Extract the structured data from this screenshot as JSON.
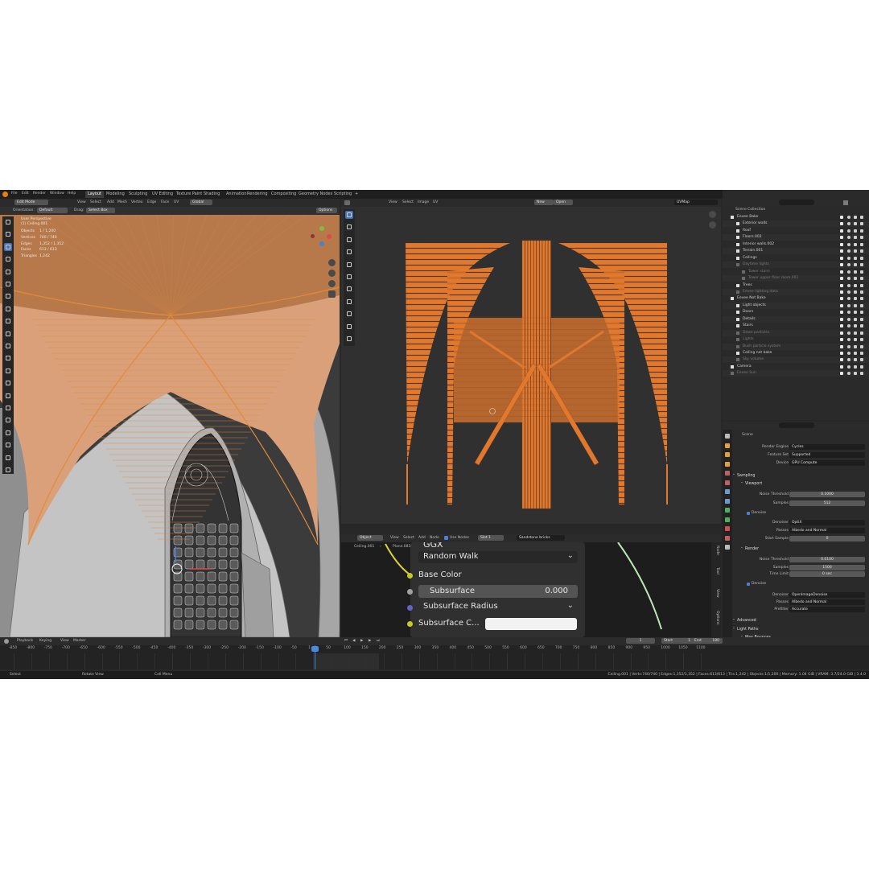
{
  "topbar": {
    "menus": [
      "File",
      "Edit",
      "Render",
      "Window",
      "Help"
    ],
    "workspaces": [
      "Layout",
      "Modeling",
      "Sculpting",
      "UV Editing",
      "Texture Paint",
      "Shading",
      "Animation",
      "Rendering",
      "Compositing",
      "Geometry Nodes",
      "Scripting"
    ],
    "active_workspace": "Layout",
    "add_tab": "+",
    "scene": "Scene",
    "view_layer": "ViewLayer"
  },
  "viewport": {
    "mode": "Edit Mode",
    "menus": [
      "View",
      "Select",
      "Add",
      "Mesh",
      "Vertex",
      "Edge",
      "Face",
      "UV"
    ],
    "transform": "Global",
    "orientation_label": "Orientation:",
    "orientation_value": "Default",
    "drag_label": "Drag:",
    "drag_value": "Select Box",
    "options": "Options",
    "title": "User Perspective",
    "object": "(1) Ceiling.001",
    "stats": [
      {
        "label": "Objects",
        "value": "1 / 1,200"
      },
      {
        "label": "Vertices",
        "value": "740 / 740"
      },
      {
        "label": "Edges",
        "value": "1,352 / 1,352"
      },
      {
        "label": "Faces",
        "value": "613 / 613"
      },
      {
        "label": "Triangles",
        "value": "1,242"
      }
    ],
    "gizmo_axes": [
      "X",
      "Y",
      "Z"
    ],
    "colors": {
      "mesh": "#d98a45",
      "wall": "#c4c4c4",
      "bg": "#3a3a3a"
    }
  },
  "uv_editor": {
    "menus": [
      "View",
      "Select",
      "Image",
      "UV"
    ],
    "new_label": "New",
    "open_label": "Open",
    "uvmap": "UVMap",
    "colors": {
      "island": "#e0782e",
      "edge": "#9a4e1e",
      "bg": "#303030"
    }
  },
  "node_editor": {
    "mode": "Object",
    "menus": [
      "View",
      "Select",
      "Add",
      "Node"
    ],
    "use_nodes": "Use Nodes",
    "slot": "Slot 1",
    "material": "Sandstone bricks",
    "breadcrumb": [
      "Ceiling.001",
      "Plane.083",
      "Sandstone bricks"
    ],
    "header_text": "GGX",
    "subsurface_method": "Random Walk",
    "sockets": [
      {
        "label": "Base Color"
      },
      {
        "label": "Subsurface",
        "value": "0.000"
      },
      {
        "label": "Subsurface Radius"
      },
      {
        "label": "Subsurface C..."
      }
    ],
    "side_tabs": [
      "Node",
      "Tool",
      "View",
      "Options"
    ]
  },
  "outliner": {
    "root": "Scene Collection",
    "items": [
      {
        "name": "Eevee Bake",
        "depth": 0
      },
      {
        "name": "Exterior walls",
        "depth": 1
      },
      {
        "name": "Roof",
        "depth": 1
      },
      {
        "name": "Floors.002",
        "depth": 1
      },
      {
        "name": "Interior walls.002",
        "depth": 1
      },
      {
        "name": "Terrain.001",
        "depth": 1
      },
      {
        "name": "Ceilings",
        "depth": 1
      },
      {
        "name": "Daytime lights",
        "depth": 1,
        "dim": true
      },
      {
        "name": "Tower stairs",
        "depth": 2,
        "dim": true
      },
      {
        "name": "Tower upper floor room.001",
        "depth": 2,
        "dim": true
      },
      {
        "name": "Trees",
        "depth": 1
      },
      {
        "name": "Eevee lighting data",
        "depth": 1,
        "dim": true
      },
      {
        "name": "Eevee Not Bake",
        "depth": 0
      },
      {
        "name": "Light objects",
        "depth": 1
      },
      {
        "name": "Doors",
        "depth": 1
      },
      {
        "name": "Details",
        "depth": 1
      },
      {
        "name": "Stairs",
        "depth": 1
      },
      {
        "name": "Dowe particles",
        "depth": 1,
        "dim": true
      },
      {
        "name": "Lights",
        "depth": 1,
        "dim": true
      },
      {
        "name": "Bush particle system",
        "depth": 1,
        "dim": true
      },
      {
        "name": "Ceiling not bake",
        "depth": 1
      },
      {
        "name": "Sky volume",
        "depth": 1,
        "dim": true
      },
      {
        "name": "Camera",
        "depth": 0
      },
      {
        "name": "Eevee Sun",
        "depth": 0,
        "dim": true
      }
    ]
  },
  "properties": {
    "context": "Scene",
    "render_engine_label": "Render Engine",
    "render_engine": "Cycles",
    "feature_set_label": "Feature Set",
    "feature_set": "Supported",
    "device_label": "Device",
    "device": "GPU Compute",
    "sampling": "Sampling",
    "viewport": "Viewport",
    "noise_threshold_label": "Noise Threshold",
    "viewport_noise_threshold": "0.1000",
    "samples_label": "Samples",
    "viewport_samples": "512",
    "denoise_label": "Denoise",
    "denoiser_label": "Denoiser",
    "viewport_denoiser": "OptiX",
    "passes_label": "Passes",
    "viewport_passes": "Albedo and Normal",
    "start_sample_label": "Start Sample",
    "viewport_start_sample": "0",
    "render": "Render",
    "render_noise_threshold": "0.0100",
    "render_samples": "1500",
    "time_limit_label": "Time Limit",
    "time_limit": "0 sec",
    "render_denoiser": "OpenImageDenoise",
    "render_passes": "Albedo and Normal",
    "prefilter_label": "Prefilter",
    "prefilter": "Accurate",
    "advanced": "Advanced",
    "light_paths": "Light Paths",
    "max_bounces": "Max Bounces",
    "total_label": "Total",
    "total": "12",
    "diffuse_label": "Diffuse",
    "diffuse": "4",
    "glossy_label": "Glossy",
    "glossy": "4"
  },
  "timeline": {
    "menus": [
      "Playback",
      "Keying",
      "View",
      "Marker"
    ],
    "current_frame": "1",
    "start_label": "Start",
    "start": "1",
    "end_label": "End",
    "end": "180",
    "ticks": [
      "-850",
      "-800",
      "-750",
      "-700",
      "-650",
      "-600",
      "-550",
      "-500",
      "-450",
      "-400",
      "-350",
      "-300",
      "-250",
      "-200",
      "-150",
      "-100",
      "-50",
      "1",
      "50",
      "100",
      "150",
      "200",
      "250",
      "300",
      "350",
      "400",
      "450",
      "500",
      "550",
      "600",
      "650",
      "700",
      "750",
      "800",
      "850",
      "900",
      "950",
      "1000",
      "1050",
      "1100"
    ]
  },
  "statusbar": {
    "left": [
      "Select",
      "Rotate View",
      "Call Menu"
    ],
    "right": "Ceiling.001 | Verts:740/740 | Edges:1,352/1,352 | Faces:613/613 | Tris:1,242 | Objects:1/1,200 | Memory: 1.04 GiB | VRAM: 3.7/24.0 GiB | 3.4.0"
  }
}
